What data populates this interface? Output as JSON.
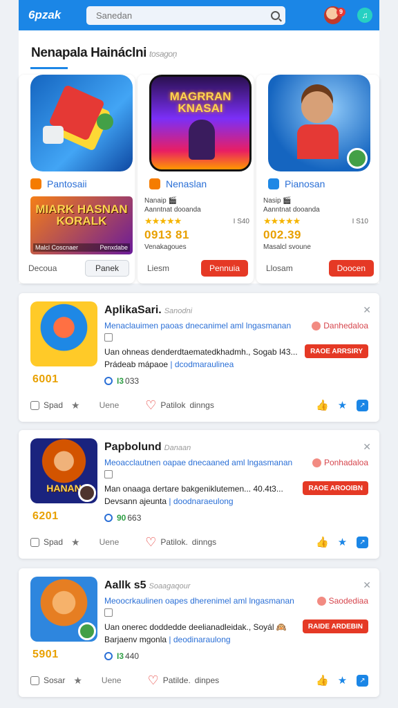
{
  "colors": {
    "primary": "#1b86e6",
    "accent_red": "#e53925",
    "price": "#e8a000",
    "star": "#f5b400"
  },
  "header": {
    "logo": "6pzak",
    "search_placeholder": "Sanedan",
    "notification_badge": "9",
    "music_icon": "music-note-icon"
  },
  "featured": {
    "title": "Nenapala Haináclni",
    "subtitle": "tosagoņ",
    "cards": [
      {
        "art_kind": "blocks",
        "chip_label": "Pantosaii",
        "chip_color": "#f57c00",
        "banner_text": "MIARK HASNAN KORALK",
        "banner_caption": "Malcl Coscnaer",
        "banner_caption_right": "Penxdabe",
        "foot_label": "Decoua",
        "button_label": "Panek",
        "button_style": "grey"
      },
      {
        "art_kind": "city",
        "art_title": "MAGRRAN KNASAI",
        "chip_label": "Nenaslan",
        "chip_color": "#f57c00",
        "info_line1": "Nanaip 🎬",
        "info_line2": "Aanntnat dooanda",
        "rating_stars": 5,
        "rating_count": "I S40",
        "price": "0913 81",
        "price_sub": "Venakagoues",
        "foot_label": "Liesm",
        "button_label": "Pennuia",
        "button_style": "red"
      },
      {
        "art_kind": "hero",
        "chip_label": "Pianosan",
        "chip_color": "#1e88e5",
        "info_line1": "Nasip 🎬",
        "info_line2": "Aanntnat dooanda",
        "rating_stars": 5,
        "rating_count": "I S10",
        "price": "002.39",
        "price_sub": "Masalcl svoune",
        "foot_label": "Llosam",
        "button_label": "Doocen",
        "button_style": "red"
      }
    ]
  },
  "list": [
    {
      "thumb_kind": "brawler",
      "title": "AplikaSari.",
      "title_sub": "Sanodni",
      "desc1": "Menaclauimen paoas dnecanimel aml lngasmanan",
      "tag": "Danhedaloa",
      "desc2": "Uan ohneas denderdtaematedkhadmh., Sogab I43...",
      "desc3_prefix": "Prádeab mápaoe ",
      "desc3_link": "| dcodmaraulinea",
      "button_label": "RAOE ARRSIRY",
      "price": "6001",
      "meta_a": "I3",
      "meta_b": "033",
      "foot_a": "Spad",
      "foot_view": "Uene",
      "foot_fav": "Patilok",
      "foot_fav_sub": "dinngs"
    },
    {
      "thumb_kind": "kingdom",
      "thumb_caption": "HANAN",
      "title": "Papbolund",
      "title_sub": "Danaan",
      "desc1": "Meoacclautnen oapae dnecaaned aml lngasmanan",
      "tag": "Ponhadaloa",
      "desc2": "Man onaaga dertare bakgeniklutemen... 40.4t3...",
      "desc3_prefix": "Devsann ajeunta ",
      "desc3_link": "| doodnaraeulong",
      "button_label": "RAOE AROOIBN",
      "price": "6201",
      "meta_a": "90",
      "meta_b": "663",
      "foot_a": "Spad",
      "foot_view": "Uene",
      "foot_fav": "Patilok.",
      "foot_fav_sub": "dinngs"
    },
    {
      "thumb_kind": "warrior",
      "title": "Aallk s5",
      "title_sub": "Soaagaqour",
      "desc1": "Meoocrkaulinen oapes dherenimel aml lngasmanan",
      "tag": "Saodediaa",
      "desc2": "Uan onerec doddedde deelianadleidak., Soyál 🙉",
      "desc3_prefix": "Barjaenv mgonla ",
      "desc3_link": "| deodinaraulong",
      "button_label": "RAIDE ARDEBIN",
      "price": "5901",
      "meta_a": "I3",
      "meta_b": "440",
      "foot_a": "Sosar",
      "foot_view": "Uene",
      "foot_fav": "Patilde.",
      "foot_fav_sub": "dinpes"
    }
  ]
}
